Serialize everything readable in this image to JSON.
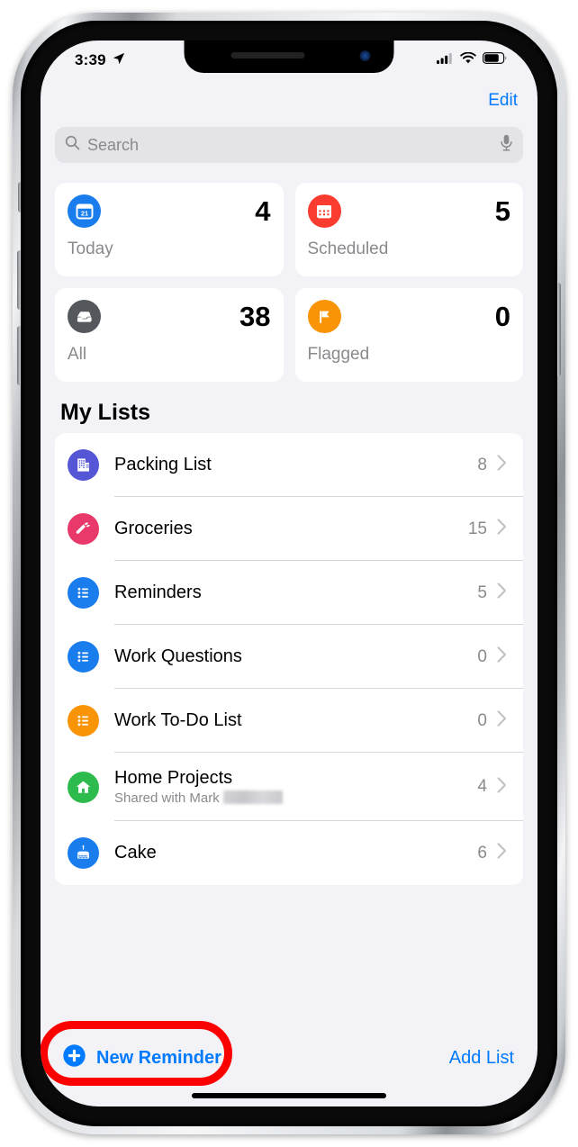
{
  "status_bar": {
    "time": "3:39",
    "location_icon": "location-arrow-icon",
    "signal_icon": "cellular-signal-icon",
    "wifi_icon": "wifi-icon",
    "battery_icon": "battery-icon"
  },
  "nav": {
    "edit_label": "Edit"
  },
  "search": {
    "placeholder": "Search",
    "search_icon": "search-icon",
    "mic_icon": "microphone-icon"
  },
  "smart_lists": [
    {
      "label": "Today",
      "count": "4",
      "icon": "calendar-day-icon",
      "icon_color": "#1a7ded",
      "day": "21"
    },
    {
      "label": "Scheduled",
      "count": "5",
      "icon": "calendar-grid-icon",
      "icon_color": "#fa3b30"
    },
    {
      "label": "All",
      "count": "38",
      "icon": "inbox-tray-icon",
      "icon_color": "#54585c"
    },
    {
      "label": "Flagged",
      "count": "0",
      "icon": "flag-icon",
      "icon_color": "#f99406"
    }
  ],
  "my_lists": {
    "title": "My Lists",
    "items": [
      {
        "name": "Packing List",
        "count": "8",
        "icon": "building-icon",
        "icon_color": "#5456d6",
        "subtitle": ""
      },
      {
        "name": "Groceries",
        "count": "15",
        "icon": "carrot-icon",
        "icon_color": "#e9396b",
        "subtitle": ""
      },
      {
        "name": "Reminders",
        "count": "5",
        "icon": "bulleted-list-icon",
        "icon_color": "#1a7ded",
        "subtitle": ""
      },
      {
        "name": "Work Questions",
        "count": "0",
        "icon": "bulleted-list-icon",
        "icon_color": "#1a7ded",
        "subtitle": ""
      },
      {
        "name": "Work To-Do List",
        "count": "0",
        "icon": "bulleted-list-icon",
        "icon_color": "#f99406",
        "subtitle": ""
      },
      {
        "name": "Home Projects",
        "count": "4",
        "icon": "house-icon",
        "icon_color": "#2dbb4e",
        "subtitle": "Shared with Mark"
      },
      {
        "name": "Cake",
        "count": "6",
        "icon": "birthday-cake-icon",
        "icon_color": "#1a7ded",
        "subtitle": ""
      }
    ]
  },
  "toolbar": {
    "new_reminder_label": "New Reminder",
    "new_reminder_icon": "plus-circle-icon",
    "add_list_label": "Add List"
  },
  "annotation": {
    "highlight_color": "#fc0000",
    "target": "new-reminder-button"
  },
  "theme": {
    "accent": "#007aff",
    "screen_background": "#f2f2f7",
    "card_background": "#ffffff",
    "secondary_text": "#8a8a8e"
  }
}
